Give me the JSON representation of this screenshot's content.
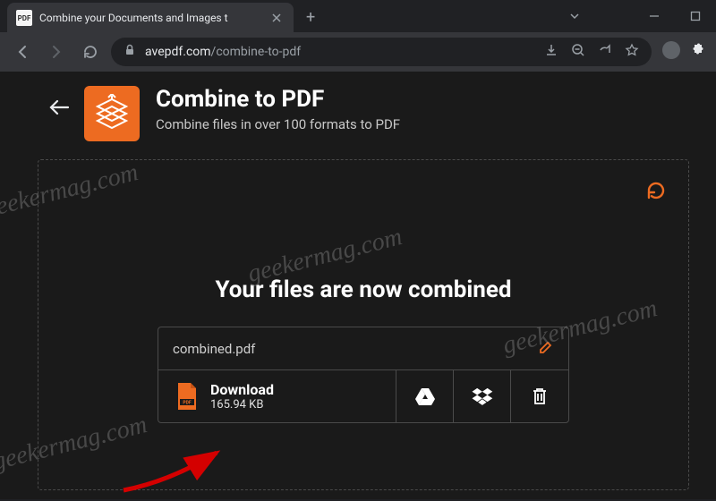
{
  "browser": {
    "tab_title": "Combine your Documents and Images t",
    "tab_favicon_text": "PDF",
    "url_host": "avepdf.com",
    "url_path": "/combine-to-pdf"
  },
  "page": {
    "title": "Combine to PDF",
    "subtitle": "Combine files in over 100 formats to PDF",
    "result_heading": "Your files are now combined",
    "filename": "combined.pdf",
    "download_label": "Download",
    "file_size": "165.94 KB"
  },
  "watermark_text": "geekermag.com",
  "colors": {
    "accent": "#ed6b21",
    "bg_dark": "#1a1a1a",
    "chrome_bg": "#35363a"
  }
}
